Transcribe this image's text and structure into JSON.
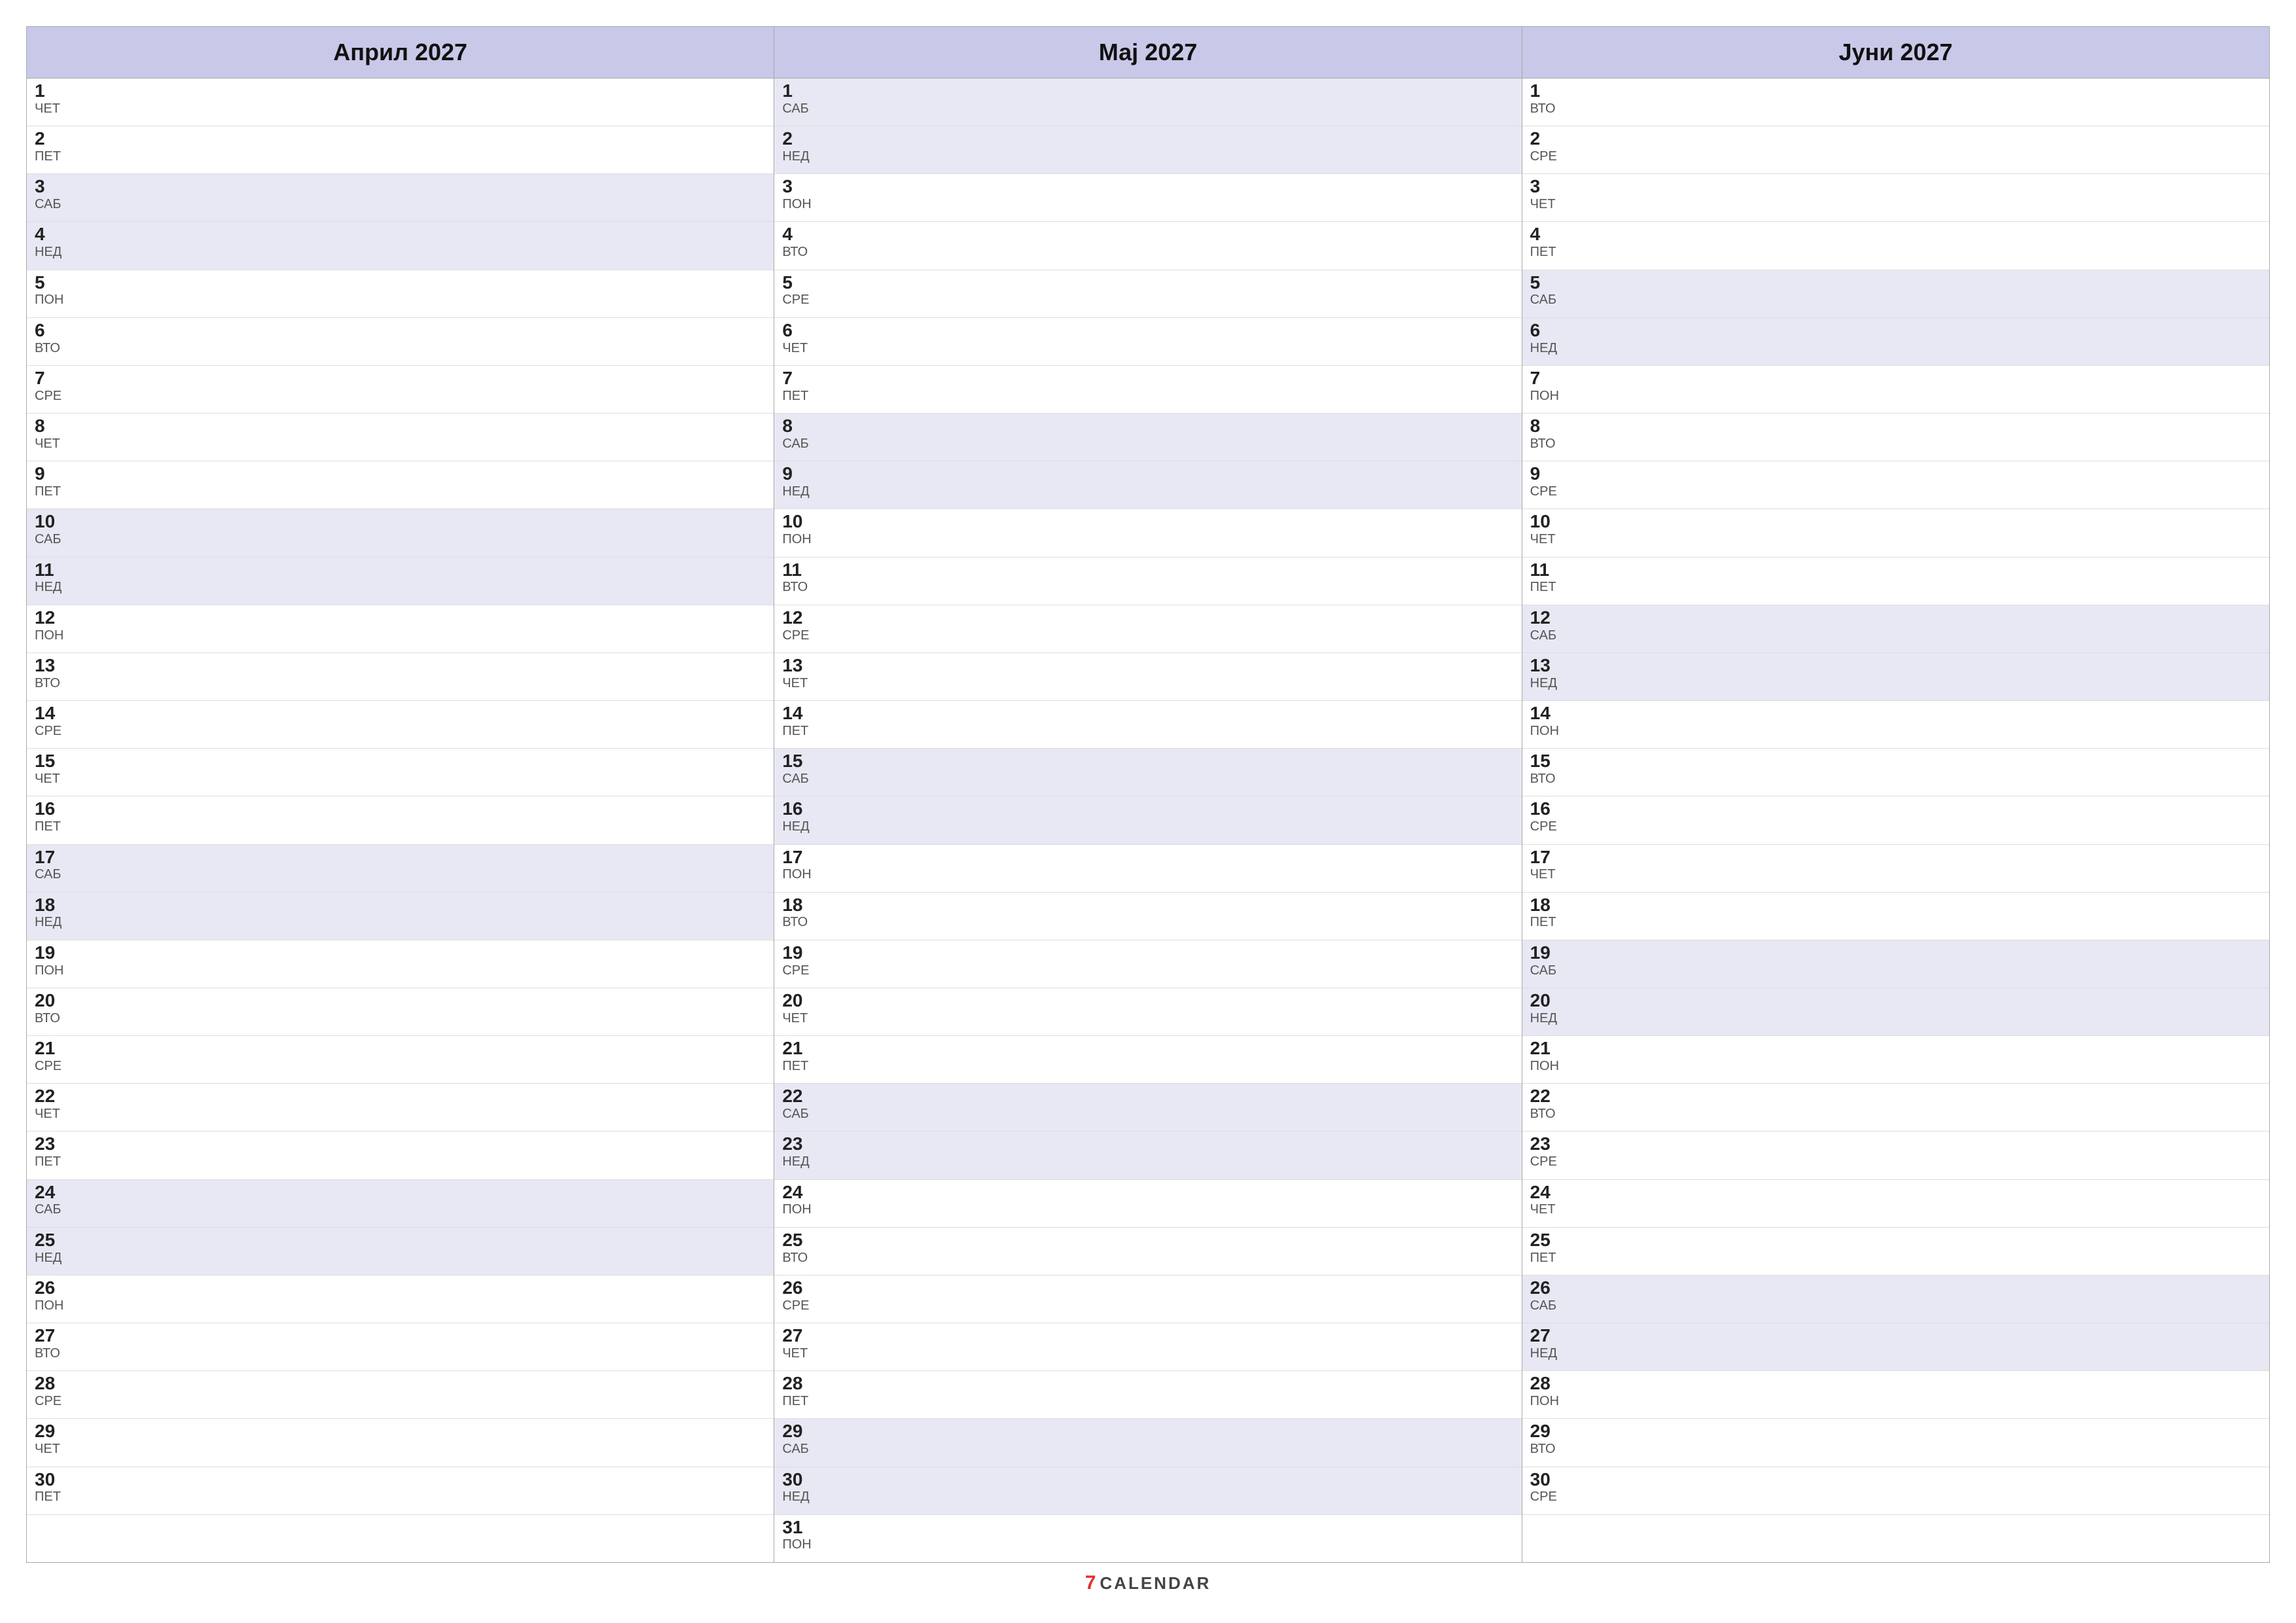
{
  "months": [
    {
      "name": "Април 2027",
      "days": [
        {
          "num": "1",
          "name": "ЧЕТ",
          "weekend": false
        },
        {
          "num": "2",
          "name": "ПЕТ",
          "weekend": false
        },
        {
          "num": "3",
          "name": "САБ",
          "weekend": true
        },
        {
          "num": "4",
          "name": "НЕД",
          "weekend": true
        },
        {
          "num": "5",
          "name": "ПОН",
          "weekend": false
        },
        {
          "num": "6",
          "name": "ВТО",
          "weekend": false
        },
        {
          "num": "7",
          "name": "СРЕ",
          "weekend": false
        },
        {
          "num": "8",
          "name": "ЧЕТ",
          "weekend": false
        },
        {
          "num": "9",
          "name": "ПЕТ",
          "weekend": false
        },
        {
          "num": "10",
          "name": "САБ",
          "weekend": true
        },
        {
          "num": "11",
          "name": "НЕД",
          "weekend": true
        },
        {
          "num": "12",
          "name": "ПОН",
          "weekend": false
        },
        {
          "num": "13",
          "name": "ВТО",
          "weekend": false
        },
        {
          "num": "14",
          "name": "СРЕ",
          "weekend": false
        },
        {
          "num": "15",
          "name": "ЧЕТ",
          "weekend": false
        },
        {
          "num": "16",
          "name": "ПЕТ",
          "weekend": false
        },
        {
          "num": "17",
          "name": "САБ",
          "weekend": true
        },
        {
          "num": "18",
          "name": "НЕД",
          "weekend": true
        },
        {
          "num": "19",
          "name": "ПОН",
          "weekend": false
        },
        {
          "num": "20",
          "name": "ВТО",
          "weekend": false
        },
        {
          "num": "21",
          "name": "СРЕ",
          "weekend": false
        },
        {
          "num": "22",
          "name": "ЧЕТ",
          "weekend": false
        },
        {
          "num": "23",
          "name": "ПЕТ",
          "weekend": false
        },
        {
          "num": "24",
          "name": "САБ",
          "weekend": true
        },
        {
          "num": "25",
          "name": "НЕД",
          "weekend": true
        },
        {
          "num": "26",
          "name": "ПОН",
          "weekend": false
        },
        {
          "num": "27",
          "name": "ВТО",
          "weekend": false
        },
        {
          "num": "28",
          "name": "СРЕ",
          "weekend": false
        },
        {
          "num": "29",
          "name": "ЧЕТ",
          "weekend": false
        },
        {
          "num": "30",
          "name": "ПЕТ",
          "weekend": false
        }
      ]
    },
    {
      "name": "Мај 2027",
      "days": [
        {
          "num": "1",
          "name": "САБ",
          "weekend": true
        },
        {
          "num": "2",
          "name": "НЕД",
          "weekend": true
        },
        {
          "num": "3",
          "name": "ПОН",
          "weekend": false
        },
        {
          "num": "4",
          "name": "ВТО",
          "weekend": false
        },
        {
          "num": "5",
          "name": "СРЕ",
          "weekend": false
        },
        {
          "num": "6",
          "name": "ЧЕТ",
          "weekend": false
        },
        {
          "num": "7",
          "name": "ПЕТ",
          "weekend": false
        },
        {
          "num": "8",
          "name": "САБ",
          "weekend": true
        },
        {
          "num": "9",
          "name": "НЕД",
          "weekend": true
        },
        {
          "num": "10",
          "name": "ПОН",
          "weekend": false
        },
        {
          "num": "11",
          "name": "ВТО",
          "weekend": false
        },
        {
          "num": "12",
          "name": "СРЕ",
          "weekend": false
        },
        {
          "num": "13",
          "name": "ЧЕТ",
          "weekend": false
        },
        {
          "num": "14",
          "name": "ПЕТ",
          "weekend": false
        },
        {
          "num": "15",
          "name": "САБ",
          "weekend": true
        },
        {
          "num": "16",
          "name": "НЕД",
          "weekend": true
        },
        {
          "num": "17",
          "name": "ПОН",
          "weekend": false
        },
        {
          "num": "18",
          "name": "ВТО",
          "weekend": false
        },
        {
          "num": "19",
          "name": "СРЕ",
          "weekend": false
        },
        {
          "num": "20",
          "name": "ЧЕТ",
          "weekend": false
        },
        {
          "num": "21",
          "name": "ПЕТ",
          "weekend": false
        },
        {
          "num": "22",
          "name": "САБ",
          "weekend": true
        },
        {
          "num": "23",
          "name": "НЕД",
          "weekend": true
        },
        {
          "num": "24",
          "name": "ПОН",
          "weekend": false
        },
        {
          "num": "25",
          "name": "ВТО",
          "weekend": false
        },
        {
          "num": "26",
          "name": "СРЕ",
          "weekend": false
        },
        {
          "num": "27",
          "name": "ЧЕТ",
          "weekend": false
        },
        {
          "num": "28",
          "name": "ПЕТ",
          "weekend": false
        },
        {
          "num": "29",
          "name": "САБ",
          "weekend": true
        },
        {
          "num": "30",
          "name": "НЕД",
          "weekend": true
        },
        {
          "num": "31",
          "name": "ПОН",
          "weekend": false
        }
      ]
    },
    {
      "name": "Јуни 2027",
      "days": [
        {
          "num": "1",
          "name": "ВТО",
          "weekend": false
        },
        {
          "num": "2",
          "name": "СРЕ",
          "weekend": false
        },
        {
          "num": "3",
          "name": "ЧЕТ",
          "weekend": false
        },
        {
          "num": "4",
          "name": "ПЕТ",
          "weekend": false
        },
        {
          "num": "5",
          "name": "САБ",
          "weekend": true
        },
        {
          "num": "6",
          "name": "НЕД",
          "weekend": true
        },
        {
          "num": "7",
          "name": "ПОН",
          "weekend": false
        },
        {
          "num": "8",
          "name": "ВТО",
          "weekend": false
        },
        {
          "num": "9",
          "name": "СРЕ",
          "weekend": false
        },
        {
          "num": "10",
          "name": "ЧЕТ",
          "weekend": false
        },
        {
          "num": "11",
          "name": "ПЕТ",
          "weekend": false
        },
        {
          "num": "12",
          "name": "САБ",
          "weekend": true
        },
        {
          "num": "13",
          "name": "НЕД",
          "weekend": true
        },
        {
          "num": "14",
          "name": "ПОН",
          "weekend": false
        },
        {
          "num": "15",
          "name": "ВТО",
          "weekend": false
        },
        {
          "num": "16",
          "name": "СРЕ",
          "weekend": false
        },
        {
          "num": "17",
          "name": "ЧЕТ",
          "weekend": false
        },
        {
          "num": "18",
          "name": "ПЕТ",
          "weekend": false
        },
        {
          "num": "19",
          "name": "САБ",
          "weekend": true
        },
        {
          "num": "20",
          "name": "НЕД",
          "weekend": true
        },
        {
          "num": "21",
          "name": "ПОН",
          "weekend": false
        },
        {
          "num": "22",
          "name": "ВТО",
          "weekend": false
        },
        {
          "num": "23",
          "name": "СРЕ",
          "weekend": false
        },
        {
          "num": "24",
          "name": "ЧЕТ",
          "weekend": false
        },
        {
          "num": "25",
          "name": "ПЕТ",
          "weekend": false
        },
        {
          "num": "26",
          "name": "САБ",
          "weekend": true
        },
        {
          "num": "27",
          "name": "НЕД",
          "weekend": true
        },
        {
          "num": "28",
          "name": "ПОН",
          "weekend": false
        },
        {
          "num": "29",
          "name": "ВТО",
          "weekend": false
        },
        {
          "num": "30",
          "name": "СРЕ",
          "weekend": false
        }
      ]
    }
  ],
  "footer": {
    "seven": "7",
    "calendar": "CALENDAR"
  }
}
